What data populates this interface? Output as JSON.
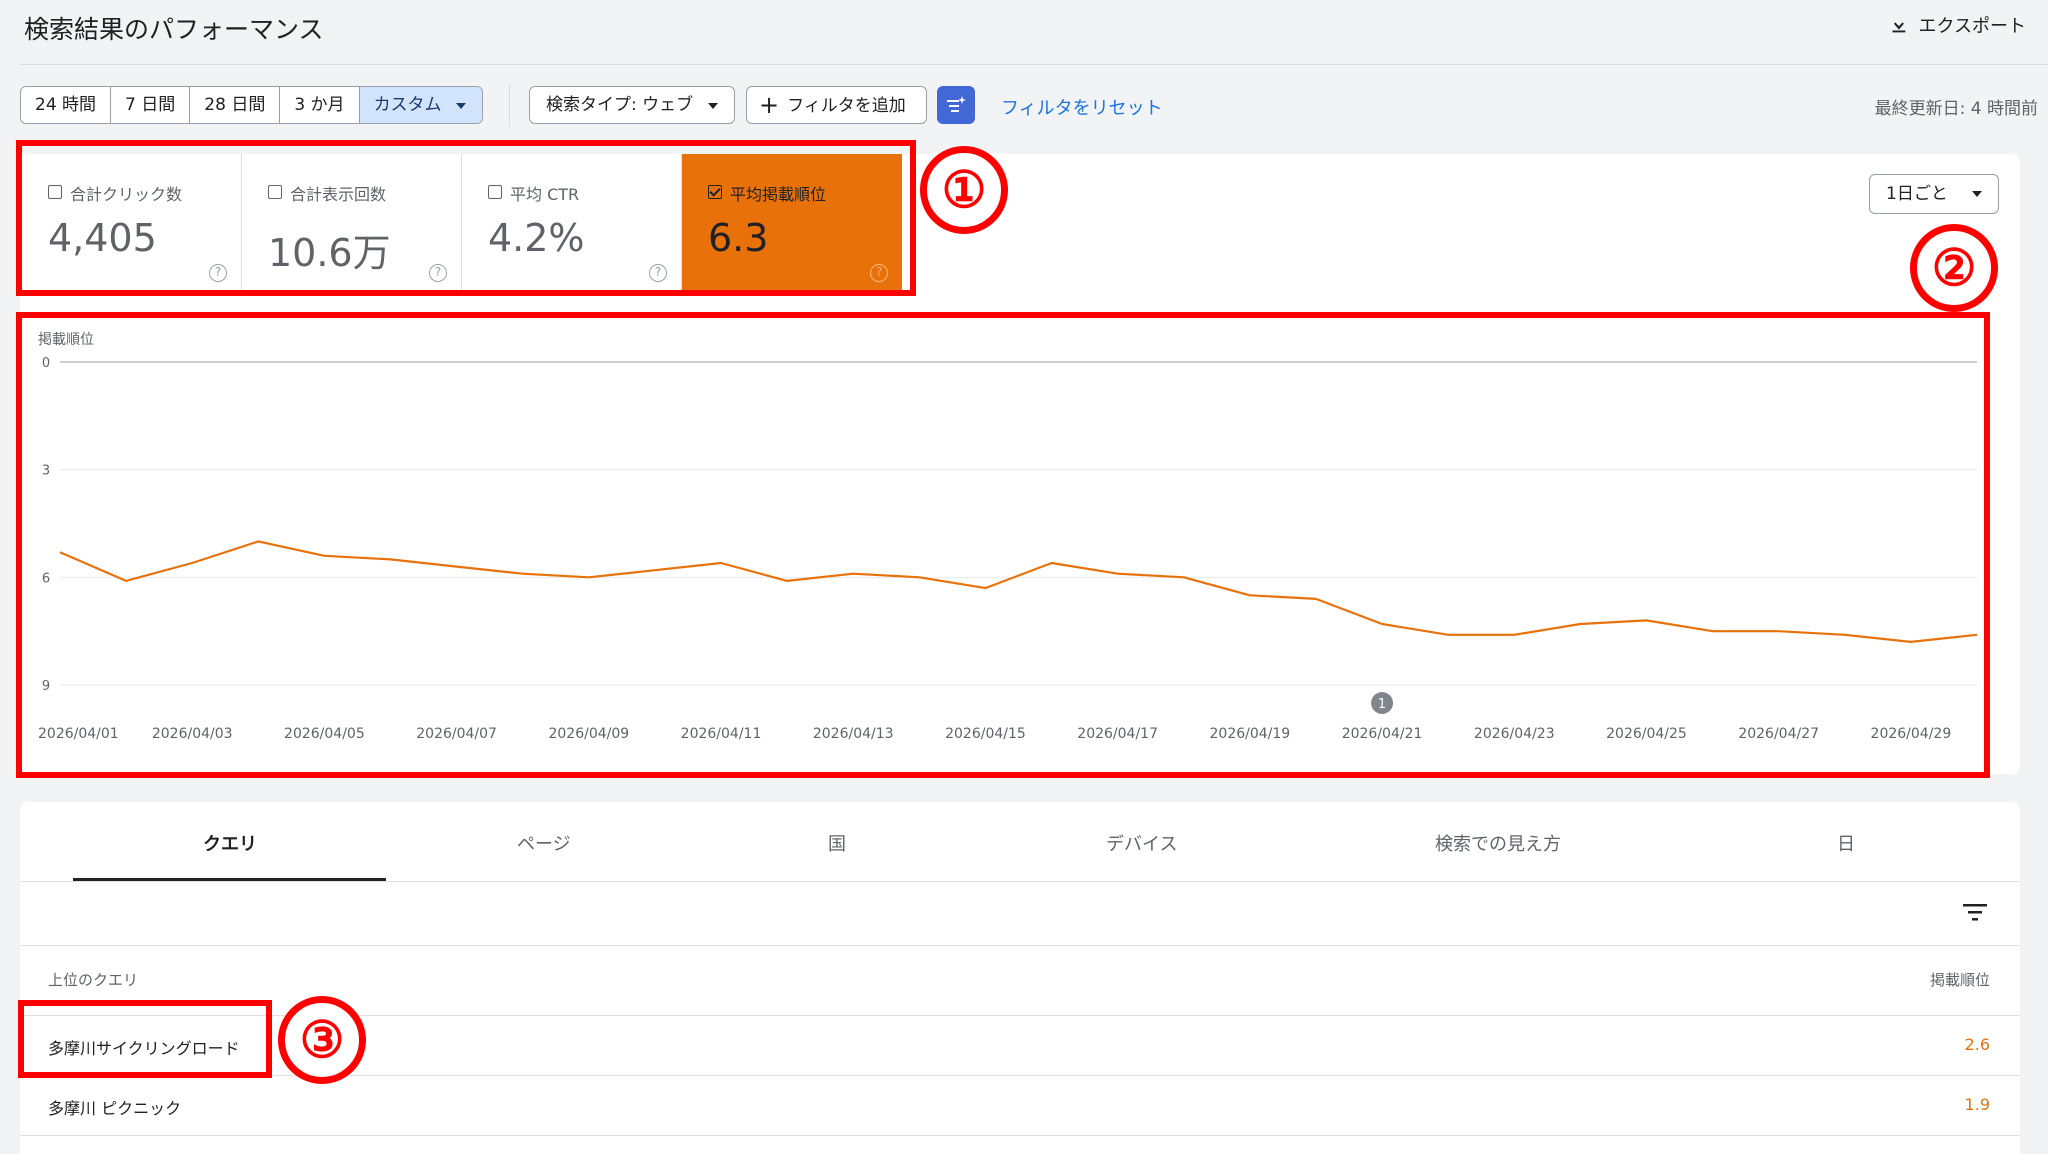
{
  "header": {
    "title": "検索結果のパフォーマンス",
    "export_label": "エクスポート"
  },
  "toolbar": {
    "ranges": [
      "24 時間",
      "7 日間",
      "28 日間",
      "3 か月",
      "カスタム"
    ],
    "active_range": "カスタム",
    "search_type": "検索タイプ: ウェブ",
    "add_filter": "フィルタを追加",
    "reset_filters": "フィルタをリセット",
    "last_updated": "最終更新日: 4 時間前"
  },
  "metrics": [
    {
      "label": "合計クリック数",
      "value": "4,405",
      "selected": false
    },
    {
      "label": "合計表示回数",
      "value": "10.6万",
      "selected": false
    },
    {
      "label": "平均 CTR",
      "value": "4.2%",
      "selected": false
    },
    {
      "label": "平均掲載順位",
      "value": "6.3",
      "selected": true
    }
  ],
  "granularity": "1日ごと",
  "chart_data": {
    "type": "line",
    "ylabel": "掲載順位",
    "yticks": [
      "0",
      "3",
      "6",
      "9"
    ],
    "ylim": [
      0,
      9
    ],
    "y_inverted": true,
    "xticks": [
      "2026/04/01",
      "2026/04/03",
      "2026/04/05",
      "2026/04/07",
      "2026/04/09",
      "2026/04/11",
      "2026/04/13",
      "2026/04/15",
      "2026/04/17",
      "2026/04/19",
      "2026/04/21",
      "2026/04/23",
      "2026/04/25",
      "2026/04/27",
      "2026/04/29"
    ],
    "annotation": {
      "x": "2026/04/21",
      "label": "1"
    },
    "series": [
      {
        "color": "#e8710a",
        "x": [
          "2026/04/01",
          "2026/04/02",
          "2026/04/03",
          "2026/04/04",
          "2026/04/05",
          "2026/04/06",
          "2026/04/07",
          "2026/04/08",
          "2026/04/09",
          "2026/04/10",
          "2026/04/11",
          "2026/04/12",
          "2026/04/13",
          "2026/04/14",
          "2026/04/15",
          "2026/04/16",
          "2026/04/17",
          "2026/04/18",
          "2026/04/19",
          "2026/04/20",
          "2026/04/21",
          "2026/04/22",
          "2026/04/23",
          "2026/04/24",
          "2026/04/25",
          "2026/04/26",
          "2026/04/27",
          "2026/04/28",
          "2026/04/29",
          "2026/04/30"
        ],
        "values": [
          5.3,
          6.1,
          5.6,
          5.0,
          5.4,
          5.5,
          5.7,
          5.9,
          6.0,
          5.8,
          5.6,
          6.1,
          5.9,
          6.0,
          6.3,
          5.6,
          5.9,
          6.0,
          6.5,
          6.6,
          7.3,
          7.6,
          7.6,
          7.3,
          7.2,
          7.5,
          7.5,
          7.6,
          7.8,
          7.6
        ]
      }
    ]
  },
  "tabs": [
    "クエリ",
    "ページ",
    "国",
    "デバイス",
    "検索での見え方",
    "日"
  ],
  "active_tab": "クエリ",
  "table": {
    "col_query": "上位のクエリ",
    "col_metric": "掲載順位",
    "rows": [
      {
        "query": "多摩川サイクリングロード",
        "value": "2.6"
      },
      {
        "query": "多摩川 ピクニック",
        "value": "1.9"
      }
    ]
  },
  "annotations": [
    "①",
    "②",
    "③"
  ],
  "colors": {
    "accent": "#e8710a",
    "highlight": "#ff0000",
    "link": "#1a73e8"
  }
}
